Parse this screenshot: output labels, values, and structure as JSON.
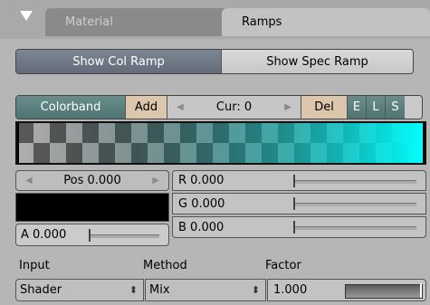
{
  "tabs": [
    {
      "label": "Material",
      "active": false
    },
    {
      "label": "Ramps",
      "active": true
    }
  ],
  "toggle": {
    "show_col_ramp": "Show Col Ramp",
    "show_spec_ramp": "Show Spec Ramp",
    "active": "Show Col Ramp"
  },
  "colorband": {
    "colorband_label": "Colorband",
    "add_label": "Add",
    "cur_label": "Cur: 0",
    "del_label": "Del",
    "e_label": "E",
    "l_label": "L",
    "s_label": "S",
    "start_color": "#000000",
    "end_color": "#00ffff"
  },
  "pos": {
    "label": "Pos 0.000"
  },
  "alpha": {
    "label": "A 0.000",
    "value": 0.0
  },
  "rgb": {
    "r_label": "R 0.000",
    "g_label": "G 0.000",
    "b_label": "B 0.000"
  },
  "bottom": {
    "input_header": "Input",
    "method_header": "Method",
    "factor_header": "Factor",
    "input_value": "Shader",
    "method_value": "Mix",
    "factor_label": "1.000",
    "factor_value": 1.0
  },
  "colors": {
    "accent_active": "#6b757f",
    "colorband_button": "#5a7c7c",
    "add_del_button": "#dcc7ad"
  }
}
